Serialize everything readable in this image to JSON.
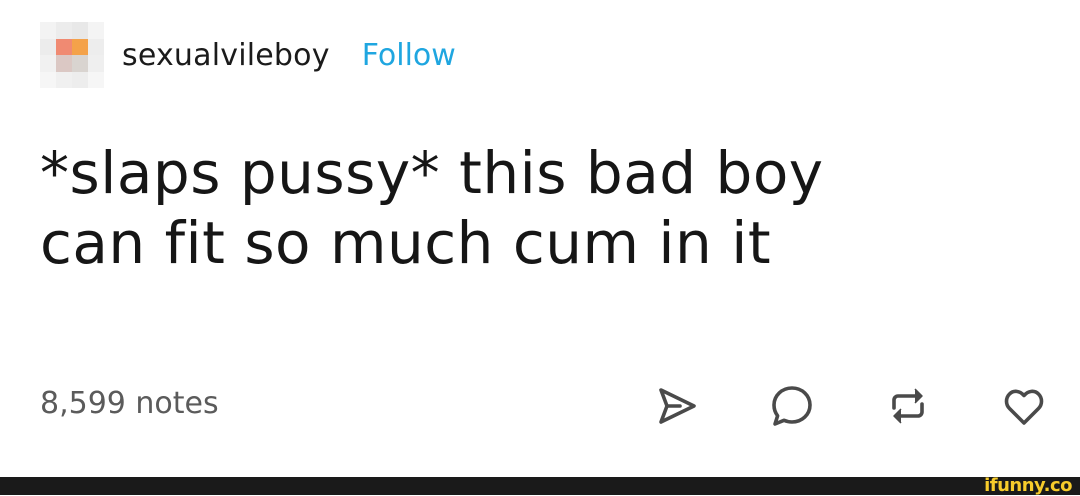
{
  "post": {
    "username": "sexualvileboy",
    "follow_label": "Follow",
    "text_lines": [
      "*slaps pussy* this bad boy",
      "can fit so much cum in it"
    ],
    "notes": "8,599 notes",
    "avatar_pixel_colors": [
      "#f3f3f3",
      "#ececec",
      "#e8e8e8",
      "#f4f4f4",
      "#ececec",
      "#f08a72",
      "#f4a24a",
      "#ededed",
      "#f1f1f1",
      "#dbc8c4",
      "#d9d4d0",
      "#efefef",
      "#f6f6f6",
      "#f0f0f0",
      "#ededed",
      "#f6f6f6"
    ],
    "actions": [
      {
        "name": "share-icon"
      },
      {
        "name": "reply-icon"
      },
      {
        "name": "reblog-icon"
      },
      {
        "name": "like-icon"
      }
    ]
  },
  "watermark": {
    "text": "ifunny.co",
    "color": "#f7cc2b",
    "bar_color": "#1a1a1a"
  },
  "colors": {
    "follow": "#1fa6e0",
    "text": "#161616",
    "notes": "#5b5b5b",
    "icons": "#4a4a4a"
  }
}
